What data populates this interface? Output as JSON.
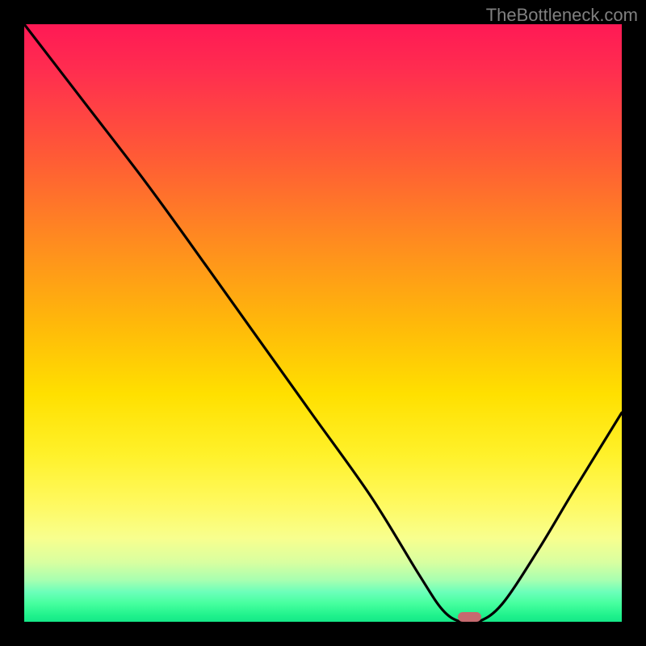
{
  "watermark": "TheBottleneck.com",
  "chart_data": {
    "type": "line",
    "title": "",
    "xlabel": "",
    "ylabel": "",
    "xlim": [
      0,
      100
    ],
    "ylim": [
      0,
      100
    ],
    "series": [
      {
        "name": "bottleneck-curve",
        "x": [
          0,
          10,
          20,
          28,
          38,
          48,
          58,
          66,
          70,
          73,
          76,
          80,
          86,
          92,
          100
        ],
        "values": [
          100,
          87,
          74,
          63,
          49,
          35,
          21,
          8,
          2,
          0,
          0,
          3,
          12,
          22,
          35
        ]
      }
    ],
    "marker": {
      "x": 74.5,
      "y": 0,
      "width": 4,
      "height": 1.6,
      "color": "#c56a6f"
    },
    "gradient_stops": [
      {
        "pos": 0.0,
        "color": "#ff1955"
      },
      {
        "pos": 0.08,
        "color": "#ff2e4f"
      },
      {
        "pos": 0.22,
        "color": "#ff5a36"
      },
      {
        "pos": 0.36,
        "color": "#ff8a20"
      },
      {
        "pos": 0.5,
        "color": "#ffb80a"
      },
      {
        "pos": 0.62,
        "color": "#ffe000"
      },
      {
        "pos": 0.72,
        "color": "#fff12a"
      },
      {
        "pos": 0.8,
        "color": "#fff95e"
      },
      {
        "pos": 0.86,
        "color": "#f8ff8e"
      },
      {
        "pos": 0.9,
        "color": "#d9ffa0"
      },
      {
        "pos": 0.93,
        "color": "#a8ffb0"
      },
      {
        "pos": 0.95,
        "color": "#6cffba"
      },
      {
        "pos": 0.97,
        "color": "#45ff9e"
      },
      {
        "pos": 0.99,
        "color": "#1ef18c"
      },
      {
        "pos": 1.0,
        "color": "#15e788"
      }
    ]
  },
  "layout": {
    "image_size": 800,
    "plot_inset": 30
  }
}
